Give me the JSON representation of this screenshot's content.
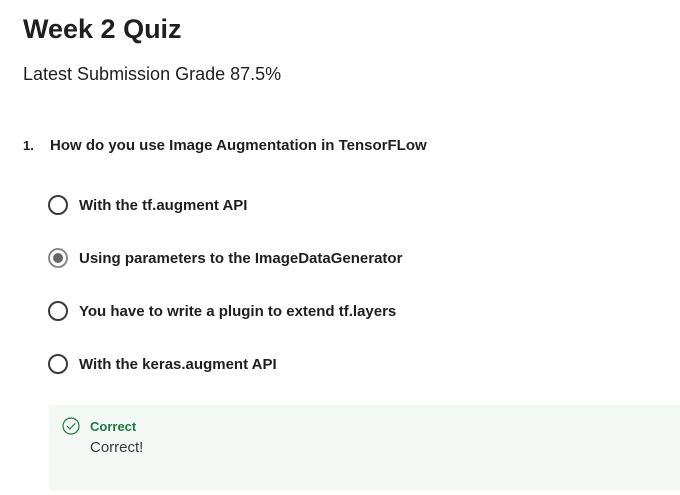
{
  "quiz": {
    "title": "Week 2 Quiz",
    "grade_label": "Latest Submission Grade",
    "grade_value": "87.5%"
  },
  "question": {
    "number": "1.",
    "text": "How do you use Image Augmentation in TensorFLow",
    "options": [
      {
        "label": "With the tf.augment API",
        "selected": false
      },
      {
        "label": "Using parameters to the ImageDataGenerator",
        "selected": true
      },
      {
        "label": "You have to write a plugin to extend tf.layers",
        "selected": false
      },
      {
        "label": "With the keras.augment API",
        "selected": false
      }
    ]
  },
  "feedback": {
    "status": "Correct",
    "message": "Correct!",
    "icon": "check-circle-icon",
    "color": "#1f7a45",
    "background": "#f3f8f5"
  }
}
